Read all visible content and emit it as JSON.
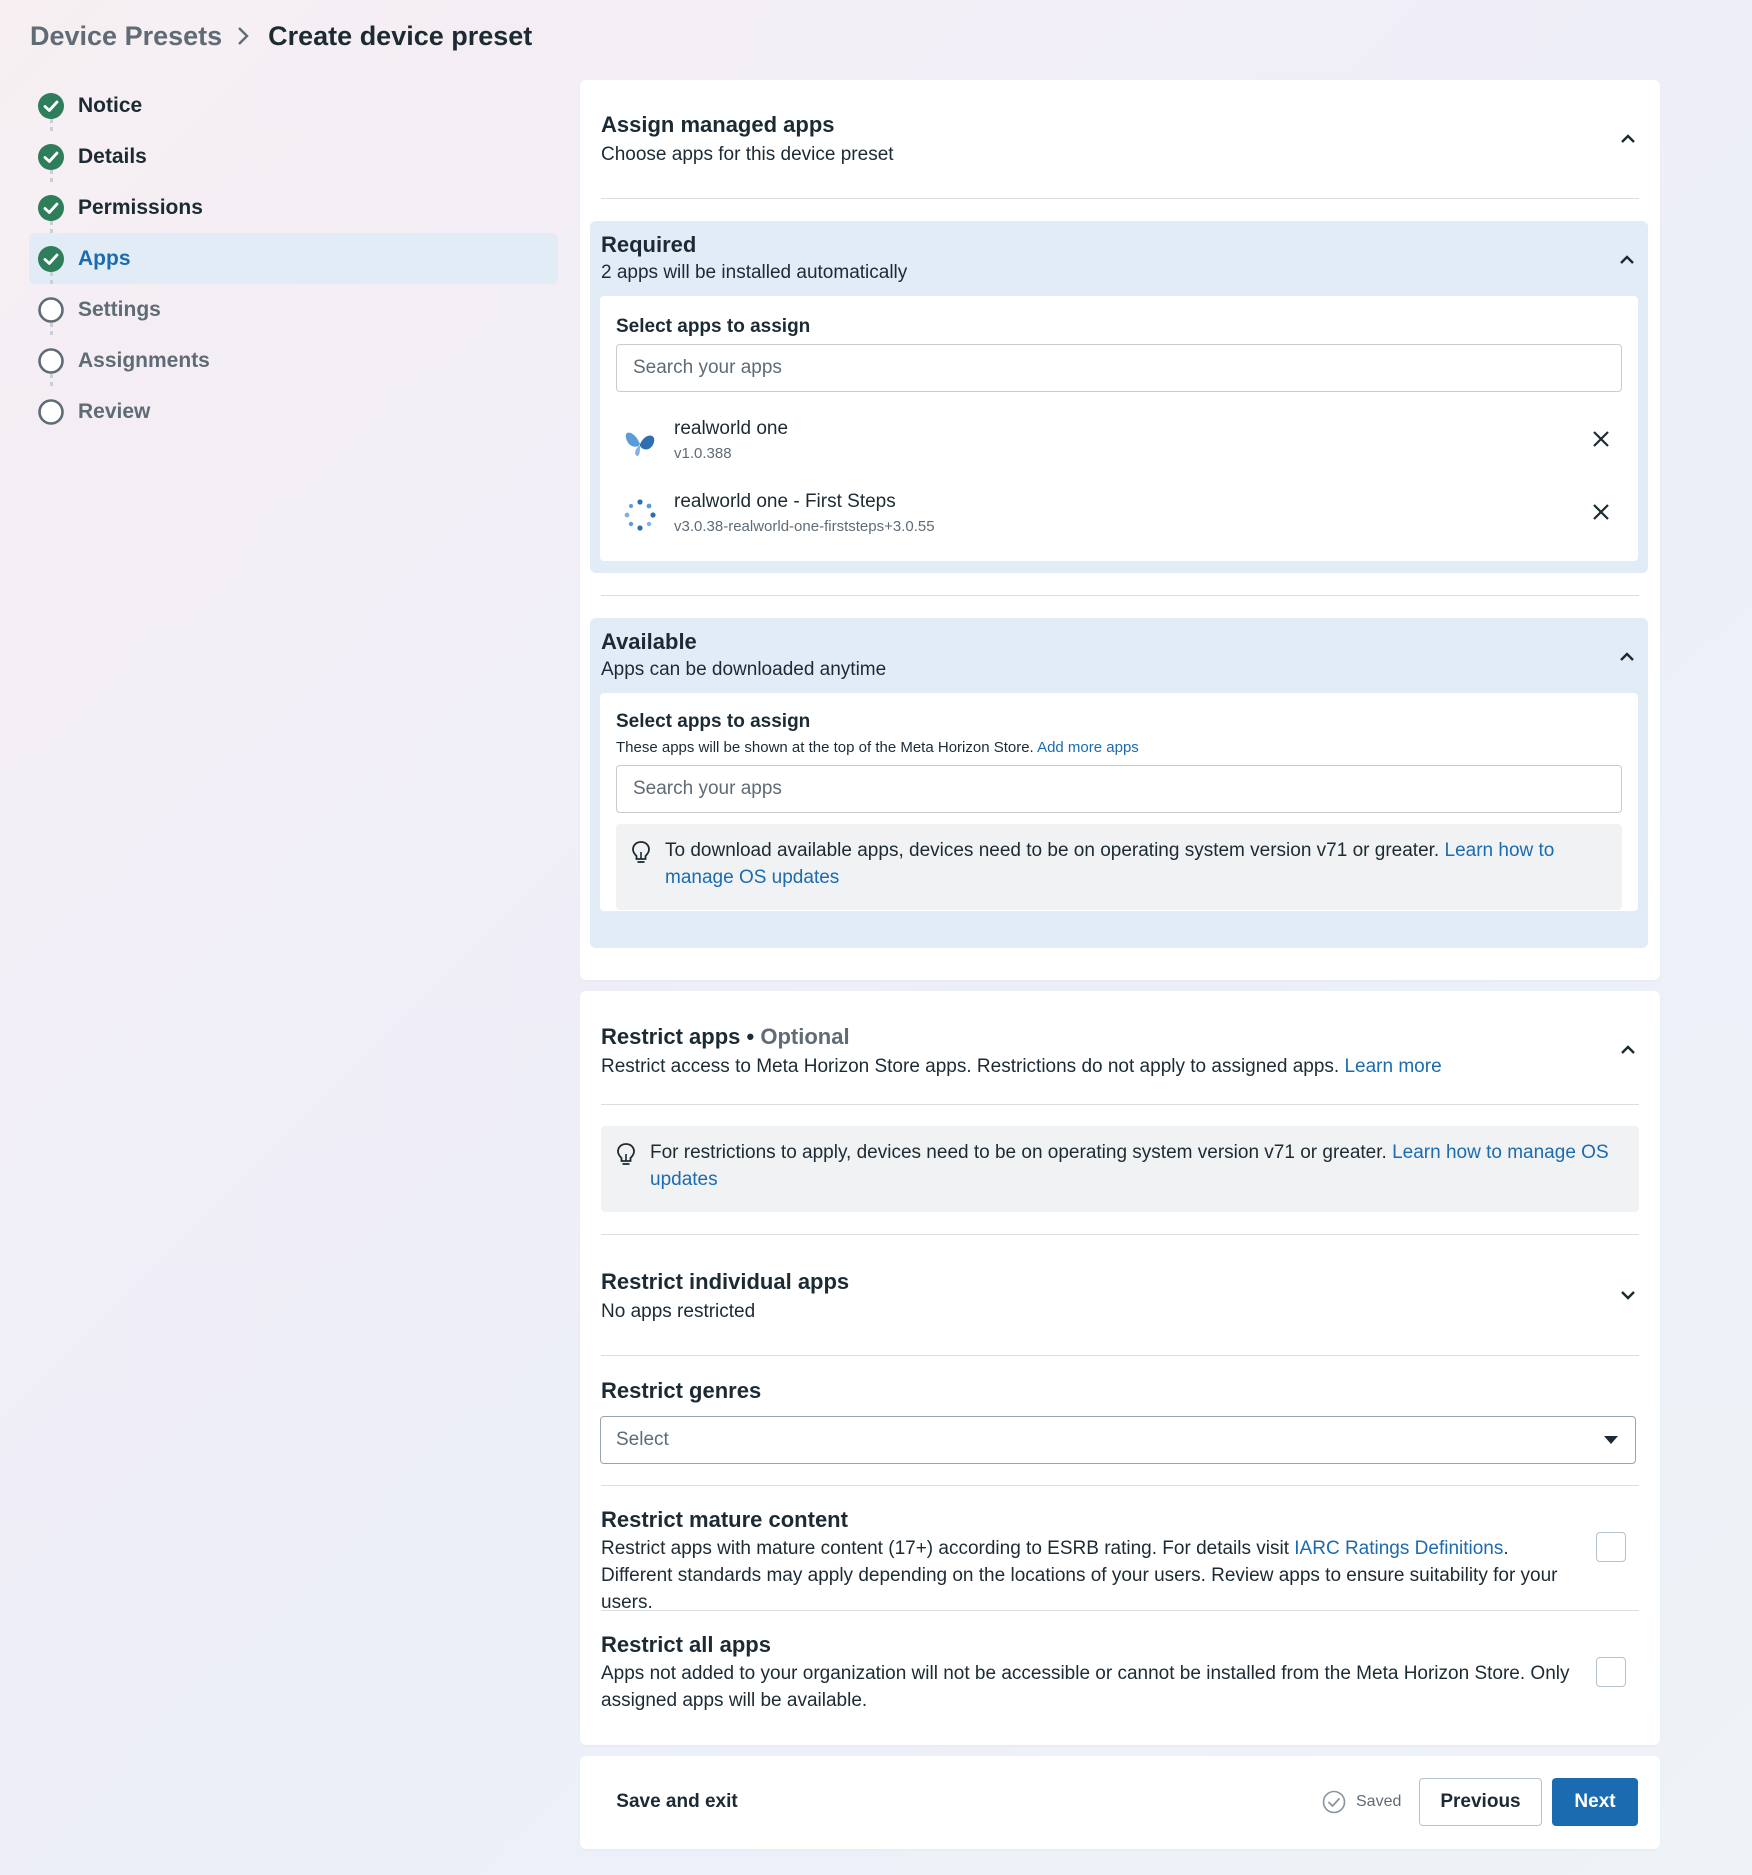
{
  "breadcrumb": {
    "parent": "Device Presets",
    "current": "Create device preset"
  },
  "steps": [
    {
      "label": "Notice",
      "state": "done"
    },
    {
      "label": "Details",
      "state": "done"
    },
    {
      "label": "Permissions",
      "state": "done"
    },
    {
      "label": "Apps",
      "state": "active"
    },
    {
      "label": "Settings",
      "state": "pending"
    },
    {
      "label": "Assignments",
      "state": "pending"
    },
    {
      "label": "Review",
      "state": "pending"
    }
  ],
  "assign": {
    "title": "Assign managed apps",
    "subtitle": "Choose apps for this device preset",
    "required": {
      "title": "Required",
      "subtitle": "2 apps will be installed automatically",
      "select_label": "Select apps to assign",
      "search_placeholder": "Search your apps",
      "apps": [
        {
          "name": "realworld one",
          "version": "v1.0.388",
          "icon": "butterfly-logo-icon"
        },
        {
          "name": "realworld one - First Steps",
          "version": "v3.0.38-realworld-one-firststeps+3.0.55",
          "icon": "dotted-circle-logo-icon"
        }
      ]
    },
    "available": {
      "title": "Available",
      "subtitle": "Apps can be downloaded anytime",
      "select_label": "Select apps to assign",
      "helper_text": "These apps will be shown at the top of the Meta Horizon Store.",
      "helper_link": "Add more apps",
      "search_placeholder": "Search your apps",
      "notice_text": "To download available apps, devices need to be on operating system version v71 or greater.",
      "notice_link": "Learn how to manage OS updates"
    }
  },
  "restrict": {
    "title": "Restrict apps",
    "optional_label": "Optional",
    "subtitle": "Restrict access to Meta Horizon Store apps. Restrictions do not apply to assigned apps.",
    "subtitle_link": "Learn more",
    "notice_text": "For restrictions to apply, devices need to be on operating system version v71 or greater.",
    "notice_link": "Learn how to manage OS updates",
    "individual": {
      "title": "Restrict individual apps",
      "subtitle": "No apps restricted"
    },
    "genres": {
      "title": "Restrict genres",
      "placeholder": "Select"
    },
    "mature": {
      "title": "Restrict mature content",
      "text_before": "Restrict apps with mature content (17+) according to ESRB rating. For details visit",
      "link": "IARC Ratings Definitions",
      "text_after": ". Different standards may apply depending on the locations of your users. Review apps to ensure suitability for your users.",
      "checked": false
    },
    "all": {
      "title": "Restrict all apps",
      "text": "Apps not added to your organization will not be accessible or cannot be installed from the Meta Horizon Store. Only assigned apps will be available.",
      "checked": false
    }
  },
  "footer": {
    "save_exit": "Save and exit",
    "saved_status": "Saved",
    "previous": "Previous",
    "next": "Next"
  },
  "colors": {
    "accent": "#1b6bb0",
    "step_done": "#2e7d5b",
    "panel_bg": "#e2ecf6"
  }
}
